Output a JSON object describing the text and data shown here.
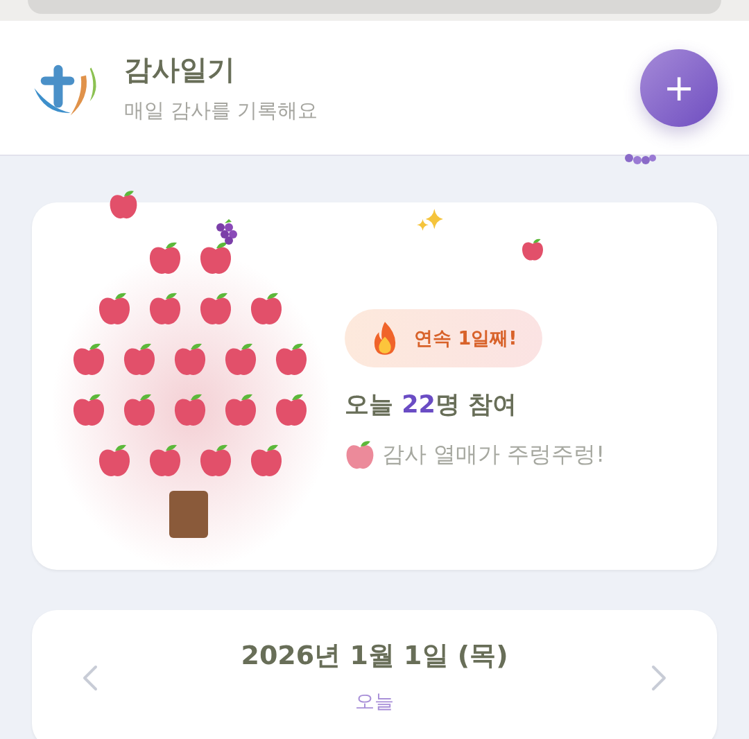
{
  "header": {
    "title": "감사일기",
    "subtitle": "매일 감사를 기록해요",
    "add_button": "+"
  },
  "tree_card": {
    "streak": "연속 1일째!",
    "participants": {
      "before": "오늘 ",
      "count": "22",
      "after": "명 참여"
    },
    "message": "감사 열매가 주렁주렁!"
  },
  "date_card": {
    "date": "2026년 1월 1일 (목)",
    "relative": "오늘"
  }
}
